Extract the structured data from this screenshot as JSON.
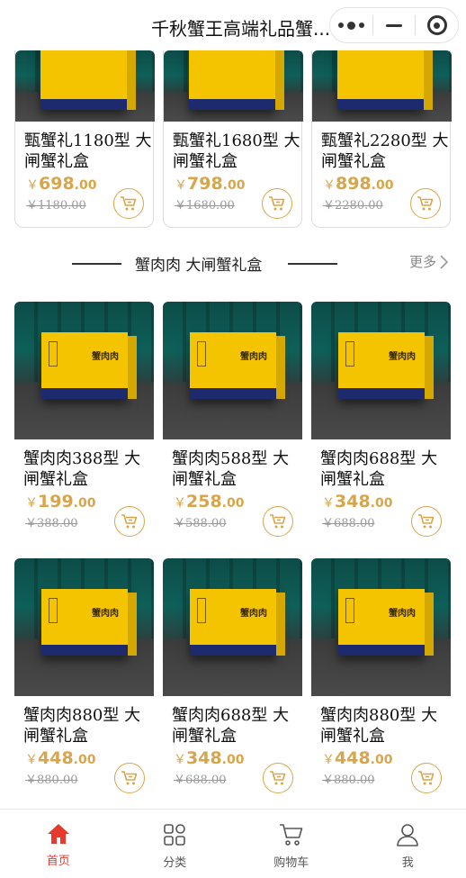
{
  "header": {
    "title": "千秋蟹王高端礼品蟹..."
  },
  "top_products": [
    {
      "name": "甄蟹礼1180型 大闸蟹礼盒",
      "price_int": "698",
      "price_dec": ".00",
      "original": "￥1180.00"
    },
    {
      "name": "甄蟹礼1680型 大闸蟹礼盒",
      "price_int": "798",
      "price_dec": ".00",
      "original": "￥1680.00"
    },
    {
      "name": "甄蟹礼2280型 大闸蟹礼盒",
      "price_int": "898",
      "price_dec": ".00",
      "original": "￥2280.00"
    }
  ],
  "section": {
    "title": "蟹肉肉 大闸蟹礼盒",
    "more": "更多"
  },
  "products": [
    {
      "name": "蟹肉肉388型 大闸蟹礼盒",
      "price_int": "199",
      "price_dec": ".00",
      "original": "￥388.00"
    },
    {
      "name": "蟹肉肉588型 大闸蟹礼盒",
      "price_int": "258",
      "price_dec": ".00",
      "original": "￥588.00"
    },
    {
      "name": "蟹肉肉688型 大闸蟹礼盒",
      "price_int": "348",
      "price_dec": ".00",
      "original": "￥688.00"
    },
    {
      "name": "蟹肉肉880型 大闸蟹礼盒",
      "price_int": "448",
      "price_dec": ".00",
      "original": "￥880.00"
    },
    {
      "name": "蟹肉肉688型 大闸蟹礼盒",
      "price_int": "348",
      "price_dec": ".00",
      "original": "￥688.00"
    },
    {
      "name": "蟹肉肉880型 大闸蟹礼盒",
      "price_int": "448",
      "price_dec": ".00",
      "original": "￥880.00"
    }
  ],
  "currency_symbol": "￥",
  "tabs": [
    {
      "label": "首页",
      "icon": "home-icon",
      "active": true
    },
    {
      "label": "分类",
      "icon": "category-icon",
      "active": false
    },
    {
      "label": "购物车",
      "icon": "cart-icon",
      "active": false
    },
    {
      "label": "我",
      "icon": "user-icon",
      "active": false
    }
  ],
  "colors": {
    "price": "#d9a54a",
    "active_tab": "#e8392e"
  }
}
